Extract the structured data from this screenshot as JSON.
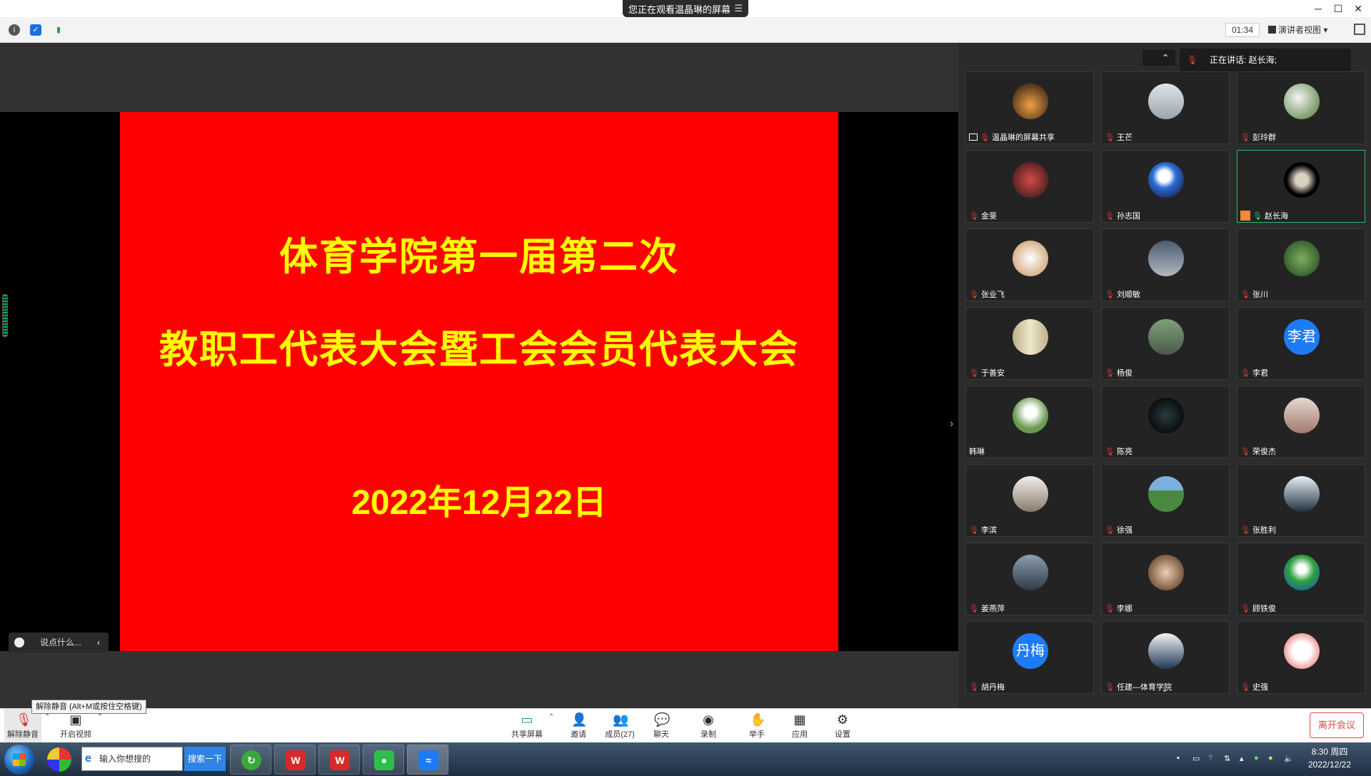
{
  "titlebar": {
    "sharing_text": "您正在观看温晶琳的屏幕",
    "minimize": "─",
    "maximize": "☐",
    "close": "✕"
  },
  "infobar": {
    "timer": "01:34",
    "view_mode": "演讲者视图"
  },
  "slide": {
    "line1": "体育学院第一届第二次",
    "line2": "教职工代表大会暨工会会员代表大会",
    "date": "2022年12月22日",
    "bg_color": "#fe0000",
    "text_color": "#ffff00"
  },
  "chat": {
    "placeholder": "说点什么..."
  },
  "speaking": {
    "label": "正在讲话: 赵长海;"
  },
  "participants": [
    {
      "name": "温晶琳的屏幕共享",
      "avatar": "photo",
      "share": true,
      "mic": "muted"
    },
    {
      "name": "王芒",
      "avatar": "photo",
      "mic": "muted"
    },
    {
      "name": "彭玲群",
      "avatar": "photo",
      "mic": "muted"
    },
    {
      "name": "金斐",
      "avatar": "photo",
      "mic": "muted"
    },
    {
      "name": "孙志国",
      "avatar": "photo",
      "mic": "muted"
    },
    {
      "name": "赵长海",
      "avatar": "photo",
      "mic": "on",
      "host": true,
      "active": true
    },
    {
      "name": "张业飞",
      "avatar": "photo",
      "mic": "muted"
    },
    {
      "name": "刘顺敏",
      "avatar": "photo",
      "mic": "muted"
    },
    {
      "name": "张川",
      "avatar": "photo",
      "mic": "muted"
    },
    {
      "name": "于善安",
      "avatar": "photo",
      "mic": "muted"
    },
    {
      "name": "杨俊",
      "avatar": "photo",
      "mic": "muted"
    },
    {
      "name": "李君",
      "avatar": "text",
      "avatar_text": "李君",
      "mic": "muted"
    },
    {
      "name": "韩琳",
      "avatar": "photo",
      "mic": "none"
    },
    {
      "name": "陈亮",
      "avatar": "photo",
      "mic": "muted"
    },
    {
      "name": "荣俊杰",
      "avatar": "photo",
      "mic": "muted"
    },
    {
      "name": "李滨",
      "avatar": "photo",
      "mic": "muted"
    },
    {
      "name": "徐强",
      "avatar": "photo",
      "mic": "muted"
    },
    {
      "name": "张胜利",
      "avatar": "photo",
      "mic": "muted"
    },
    {
      "name": "姜燕萍",
      "avatar": "photo",
      "mic": "muted"
    },
    {
      "name": "李娜",
      "avatar": "photo",
      "mic": "muted"
    },
    {
      "name": "顾铁俊",
      "avatar": "photo",
      "mic": "muted"
    },
    {
      "name": "胡丹梅",
      "avatar": "text",
      "avatar_text": "丹梅",
      "mic": "muted"
    },
    {
      "name": "任建—体育学院",
      "avatar": "photo",
      "mic": "muted"
    },
    {
      "name": "史强",
      "avatar": "photo",
      "mic": "muted"
    }
  ],
  "toolbar": {
    "unmute": "解除静音",
    "video": "开启视频",
    "share": "共享屏幕",
    "invite": "邀请",
    "members": "成员(27)",
    "chat": "聊天",
    "record": "录制",
    "raise_hand": "举手",
    "apps": "应用",
    "settings": "设置",
    "leave": "离开会议",
    "tooltip": "解除静音 (Alt+M或按住空格键)"
  },
  "taskbar": {
    "search_placeholder": "输入你想搜的",
    "search_button": "搜索一下",
    "time": "8:30 周四",
    "date": "2022/12/22"
  }
}
